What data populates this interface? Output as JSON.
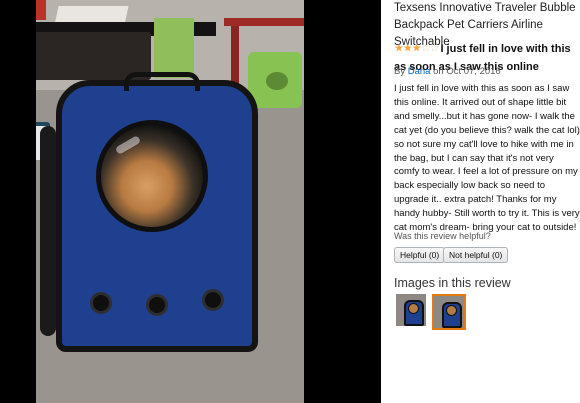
{
  "product": {
    "title": "Texsens Innovative Traveler Bubble Backpack Pet Carriers Airline Switchable"
  },
  "review": {
    "rating": 3,
    "max_rating": 5,
    "star_icon": "star-icon",
    "title": "I just fell in love with this as soon as I saw this online",
    "by_prefix": "By",
    "author": "Dana",
    "date_prefix": "on",
    "date": "Oct 07, 2016",
    "body": "I just fell in love with this as soon as I saw this online. It arrived out of shape little bit and smelly...but it has gone now- I walk the cat yet (do you believe this? walk the cat lol) so not sure my cat'll love to hike with me in the bag, but I can say that it's not very comfy to wear. I feel a lot of pressure on my back especially low back so need to upgrade it.. extra patch! Thanks for my handy hubby- Still worth to try it. This is very cat mom's dream- bring your cat to outside!",
    "helpful_question": "Was this review helpful?",
    "helpful_button": "Helpful (0)",
    "not_helpful_button": "Not helpful (0)"
  },
  "images_section": {
    "heading": "Images in this review",
    "thumbnails": [
      {
        "name": "review-image-1",
        "selected": false
      },
      {
        "name": "review-image-2",
        "selected": true
      }
    ]
  },
  "colors": {
    "link": "#0066c0",
    "star": "#f3a847",
    "selected_border": "#e47911",
    "backpack": "#1f3f8f"
  }
}
